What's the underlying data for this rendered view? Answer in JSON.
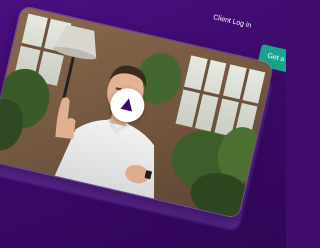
{
  "nav": {
    "login_label": "Client Log in",
    "cta_label": "Get a",
    "cta_color": "#19a58d"
  },
  "video": {
    "play_icon": "play-icon",
    "background_color": "#3f0b6e"
  }
}
